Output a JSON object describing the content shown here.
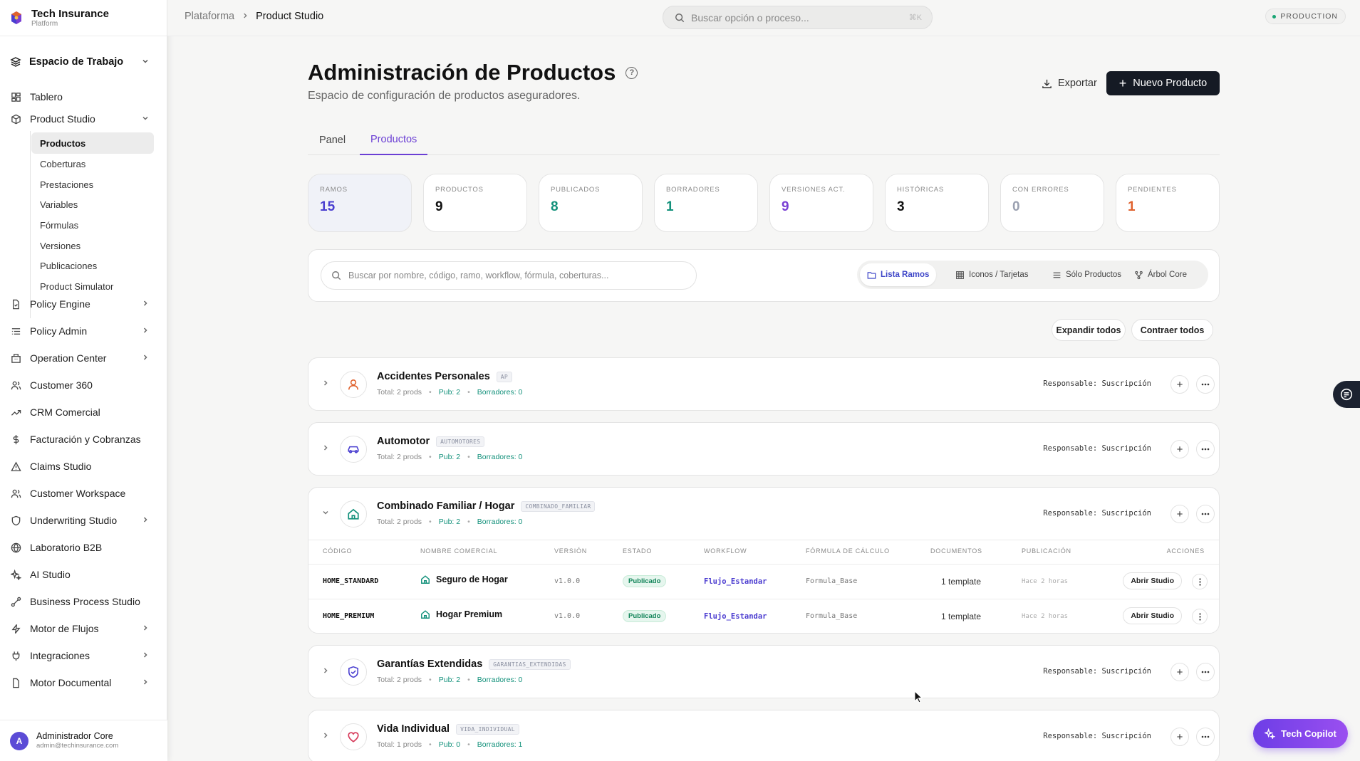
{
  "brand": {
    "title": "Tech Insurance",
    "subtitle": "Platform"
  },
  "sidebar": {
    "workspace": "Espacio de Trabajo",
    "items": [
      {
        "label": "Tablero",
        "icon": "dashboard-icon"
      },
      {
        "label": "Product Studio",
        "icon": "cube-icon"
      },
      {
        "label": "Policy Engine",
        "icon": "file-icon"
      },
      {
        "label": "Policy Admin",
        "icon": "list-icon"
      },
      {
        "label": "Operation Center",
        "icon": "building-icon"
      },
      {
        "label": "Customer 360",
        "icon": "users-icon"
      },
      {
        "label": "CRM Comercial",
        "icon": "trend-icon"
      },
      {
        "label": "Facturación y Cobranzas",
        "icon": "dollar-icon"
      },
      {
        "label": "Claims Studio",
        "icon": "alert-icon"
      },
      {
        "label": "Customer Workspace",
        "icon": "users-icon"
      },
      {
        "label": "Underwriting Studio",
        "icon": "shield-icon"
      },
      {
        "label": "Laboratorio B2B",
        "icon": "globe-icon"
      },
      {
        "label": "AI Studio",
        "icon": "sparkle-icon"
      },
      {
        "label": "Business Process Studio",
        "icon": "workflow-icon"
      },
      {
        "label": "Motor de Flujos",
        "icon": "bolt-icon"
      },
      {
        "label": "Integraciones",
        "icon": "plug-icon"
      },
      {
        "label": "Motor Documental",
        "icon": "doc-icon"
      }
    ],
    "sub_items": [
      "Productos",
      "Coberturas",
      "Prestaciones",
      "Variables",
      "Fórmulas",
      "Versiones",
      "Publicaciones",
      "Product Simulator"
    ]
  },
  "user": {
    "initial": "A",
    "name": "Administrador Core",
    "email": "admin@techinsurance.com"
  },
  "topbar": {
    "crumb_root": "Plataforma",
    "crumb_current": "Product Studio",
    "search_placeholder": "Buscar opción o proceso...",
    "search_shortcut": "⌘K",
    "env": "PRODUCTION"
  },
  "page": {
    "title": "Administración de Productos",
    "subtitle": "Espacio de configuración de productos aseguradores.",
    "export_label": "Exportar",
    "new_label": "Nuevo Producto",
    "tabs": [
      "Panel",
      "Productos"
    ]
  },
  "stats": [
    {
      "label": "RAMOS",
      "value": "15",
      "color": "#4a3fd0"
    },
    {
      "label": "PRODUCTOS",
      "value": "9",
      "color": "#111111"
    },
    {
      "label": "PUBLICADOS",
      "value": "8",
      "color": "#13917b"
    },
    {
      "label": "BORRADORES",
      "value": "1",
      "color": "#13917b"
    },
    {
      "label": "VERSIONES ACT.",
      "value": "9",
      "color": "#7a3fd4"
    },
    {
      "label": "HISTÓRICAS",
      "value": "3",
      "color": "#111111"
    },
    {
      "label": "CON ERRORES",
      "value": "0",
      "color": "#9aa0b0"
    },
    {
      "label": "PENDIENTES",
      "value": "1",
      "color": "#e0622e"
    }
  ],
  "filter": {
    "placeholder": "Buscar por nombre, código, ramo, workflow, fórmula, coberturas...",
    "views": [
      "Lista Ramos",
      "Iconos / Tarjetas",
      "Sólo Productos",
      "Árbol Core"
    ]
  },
  "actions": {
    "expand": "Expandir todos",
    "collapse": "Contraer todos"
  },
  "groups": [
    {
      "name": "Accidentes Personales",
      "code": "AP",
      "total": "Total: 2 prods",
      "pub": "Pub: 2",
      "drafts": "Borradores: 0",
      "resp": "Responsable: Suscripción",
      "icon": "user-icon",
      "icon_color": "#e0622e"
    },
    {
      "name": "Automotor",
      "code": "AUTOMOTORES",
      "total": "Total: 2 prods",
      "pub": "Pub: 2",
      "drafts": "Borradores: 0",
      "resp": "Responsable: Suscripción",
      "icon": "car-icon",
      "icon_color": "#4a3fd0"
    },
    {
      "name": "Combinado Familiar / Hogar",
      "code": "COMBINADO_FAMILIAR",
      "total": "Total: 2 prods",
      "pub": "Pub: 2",
      "drafts": "Borradores: 0",
      "resp": "Responsable: Suscripción",
      "icon": "home-icon",
      "icon_color": "#13917b"
    },
    {
      "name": "Garantías Extendidas",
      "code": "GARANTIAS_EXTENDIDAS",
      "total": "Total: 2 prods",
      "pub": "Pub: 2",
      "drafts": "Borradores: 0",
      "resp": "Responsable: Suscripción",
      "icon": "shield-check-icon",
      "icon_color": "#4a3fd0"
    },
    {
      "name": "Vida Individual",
      "code": "VIDA_INDIVIDUAL",
      "total": "Total: 1 prods",
      "pub": "Pub: 0",
      "drafts": "Borradores: 1",
      "resp": "Responsable: Suscripción",
      "icon": "heart-icon",
      "icon_color": "#d63a5a"
    }
  ],
  "table": {
    "headers": [
      "CÓDIGO",
      "NOMBRE COMERCIAL",
      "VERSIÓN",
      "ESTADO",
      "WORKFLOW",
      "FÓRMULA DE CÁLCULO",
      "DOCUMENTOS",
      "PUBLICACIÓN",
      "ACCIONES"
    ],
    "rows": [
      {
        "code": "HOME_STANDARD",
        "name": "Seguro de Hogar",
        "version": "v1.0.0",
        "status": "Publicado",
        "workflow": "Flujo_Estandar",
        "formula": "Formula_Base",
        "docs": "1 template",
        "published": "Hace 2 horas",
        "action": "Abrir Studio"
      },
      {
        "code": "HOME_PREMIUM",
        "name": "Hogar Premium",
        "version": "v1.0.0",
        "status": "Publicado",
        "workflow": "Flujo_Estandar",
        "formula": "Formula_Base",
        "docs": "1 template",
        "published": "Hace 2 horas",
        "action": "Abrir Studio"
      }
    ]
  },
  "copilot": "Tech Copilot"
}
